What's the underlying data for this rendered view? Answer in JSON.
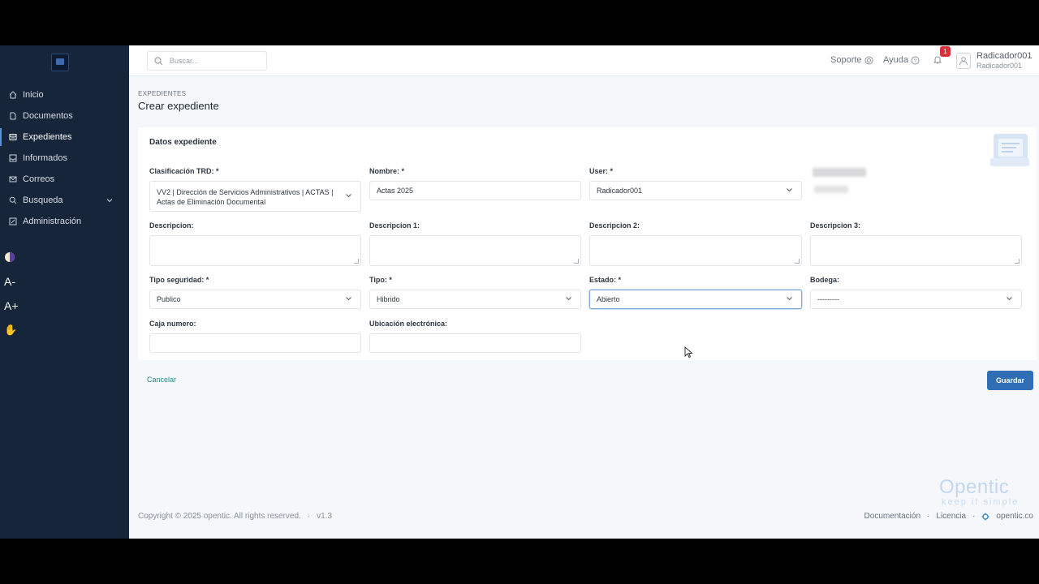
{
  "sidebar": {
    "items": [
      {
        "label": "Inicio",
        "icon": "home-icon"
      },
      {
        "label": "Documentos",
        "icon": "document-icon"
      },
      {
        "label": "Expedientes",
        "icon": "folder-icon",
        "active": true
      },
      {
        "label": "Informados",
        "icon": "inbox-icon"
      },
      {
        "label": "Correos",
        "icon": "mail-icon"
      },
      {
        "label": "Busqueda",
        "icon": "search-icon"
      },
      {
        "label": "Administración",
        "icon": "edit-icon"
      }
    ],
    "tools": {
      "contrast": "contrast-icon",
      "font_smaller": "A-",
      "font_larger": "A+",
      "hand": "✋"
    }
  },
  "topbar": {
    "search_placeholder": "Buscar...",
    "support": "Soporte",
    "help": "Ayuda",
    "notifications_count": "1",
    "user_name": "Radicador001",
    "user_role": "Radicador001"
  },
  "page": {
    "breadcrumb": "EXPEDIENTES",
    "title": "Crear expediente"
  },
  "form": {
    "section_title": "Datos expediente",
    "clasificacion": {
      "label": "Clasificación TRD: *",
      "value": "VV2 | Dirección de Servicios Administrativos | ACTAS | Actas de Eliminación Documental"
    },
    "nombre": {
      "label": "Nombre: *",
      "value": "Actas 2025"
    },
    "user": {
      "label": "User: *",
      "value": "Radicador001"
    },
    "descripcion": {
      "label": "Descripcion:",
      "value": ""
    },
    "descripcion1": {
      "label": "Descripcion 1:",
      "value": ""
    },
    "descripcion2": {
      "label": "Descripcion 2:",
      "value": ""
    },
    "descripcion3": {
      "label": "Descripcion 3:",
      "value": ""
    },
    "tipo_seguridad": {
      "label": "Tipo seguridad: *",
      "value": "Publico"
    },
    "tipo": {
      "label": "Tipo: *",
      "value": "Hibrido"
    },
    "estado": {
      "label": "Estado: *",
      "value": "Abierto"
    },
    "bodega": {
      "label": "Bodega:",
      "value": "---------"
    },
    "caja_numero": {
      "label": "Caja numero:",
      "value": ""
    },
    "ubicacion": {
      "label": "Ubicación electrónica:",
      "value": ""
    }
  },
  "actions": {
    "cancel": "Cancelar",
    "save": "Guardar"
  },
  "brand": {
    "name": "Opentic",
    "tagline": "keep it simple"
  },
  "footer": {
    "copyright": "Copyright © 2025 opentic. All rights reserved.",
    "separator": "·",
    "version": "v1.3",
    "links": {
      "docs": "Documentación",
      "license": "Licencia",
      "site": "opentic.co"
    }
  },
  "colors": {
    "sidebar": "#17253a",
    "primary": "#2f6db5",
    "badge": "#d6323a",
    "link": "#2a8a8f"
  }
}
